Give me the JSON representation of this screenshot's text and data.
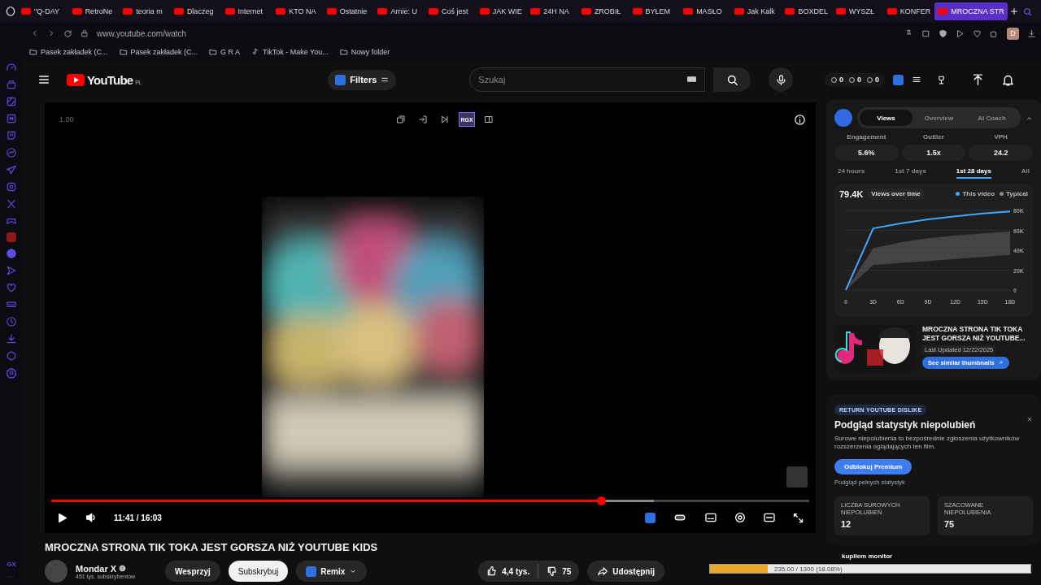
{
  "browser": {
    "tabs": [
      {
        "title": "\"Q-DAY",
        "selected": false
      },
      {
        "title": "RetroNe",
        "selected": false
      },
      {
        "title": "teoria m",
        "selected": false
      },
      {
        "title": "Dlaczeg",
        "selected": false
      },
      {
        "title": "Internet",
        "selected": false
      },
      {
        "title": "KTO NA",
        "selected": false
      },
      {
        "title": "Ostatnie",
        "selected": false
      },
      {
        "title": "Arnie: U",
        "selected": false
      },
      {
        "title": "Coś jest",
        "selected": false
      },
      {
        "title": "JAK WIE",
        "selected": false
      },
      {
        "title": "24H NA",
        "selected": false
      },
      {
        "title": "ZROBIŁ",
        "selected": false
      },
      {
        "title": "BYŁEM",
        "selected": false
      },
      {
        "title": "MASŁO",
        "selected": false
      },
      {
        "title": "Jak Kalk",
        "selected": false
      },
      {
        "title": "BOXDEL",
        "selected": false
      },
      {
        "title": "WYSZŁ",
        "selected": false
      },
      {
        "title": "KONFER",
        "selected": false
      },
      {
        "title": "MROCZNA STR",
        "selected": true
      }
    ],
    "url": "www.youtube.com/watch",
    "profile": "D",
    "bookmarks": [
      {
        "kind": "folder",
        "label": "Pasek zakładek (C..."
      },
      {
        "kind": "folder",
        "label": "Pasek zakładek (C..."
      },
      {
        "kind": "folder",
        "label": "G R A"
      },
      {
        "kind": "tiktok",
        "label": "TikTok - Make You..."
      },
      {
        "kind": "folder",
        "label": "Nowy folder"
      }
    ],
    "sidebar_footer": "GX"
  },
  "header": {
    "logo": "YouTube",
    "region": "PL",
    "filters": "Filters",
    "search": {
      "placeholder": "Szukaj"
    },
    "counters": [
      "0",
      "0",
      "0"
    ]
  },
  "player": {
    "speed": "1.00",
    "toolbar": [
      {
        "kind": "pip",
        "selected": false
      },
      {
        "kind": "enter",
        "selected": false
      },
      {
        "kind": "next",
        "selected": false
      },
      {
        "kind": "text",
        "label": "RGX",
        "selected": true
      },
      {
        "kind": "side",
        "selected": false
      }
    ],
    "progress": {
      "level": 0.725
    },
    "buffered": {
      "level": 0.795
    },
    "time": "11:41 / 16:03"
  },
  "video": {
    "title": "MROCZNA STRONA TIK TOKA JEST GORSZA NIŻ YOUTUBE KIDS",
    "channel": "Mondar X",
    "subscribers": "451 tys. subskrybentów",
    "support": "Wesprzyj",
    "subscribe": "Subskrybuj",
    "remix": "Remix",
    "likes": "4,4 tys.",
    "dislikes": "75",
    "share": "Udostępnij"
  },
  "analytics": {
    "tabs": [
      {
        "label": "Views",
        "selected": true
      },
      {
        "label": "Overview",
        "selected": false
      },
      {
        "label": "AI Coach",
        "selected": false
      }
    ],
    "stats": [
      {
        "label": "Engagement",
        "value": "5.6%"
      },
      {
        "label": "Outlier",
        "value": "1.5x"
      },
      {
        "label": "VPH",
        "value": "24.2"
      }
    ],
    "ranges": [
      {
        "label": "24 hours",
        "selected": false
      },
      {
        "label": "1st 7 days",
        "selected": false
      },
      {
        "label": "1st 28 days",
        "selected": true
      },
      {
        "label": "All",
        "selected": false
      }
    ],
    "total": "79.4K",
    "metric": "Views over time",
    "chart_data": {
      "type": "line",
      "categories": [
        "0",
        "3D",
        "6D",
        "9D",
        "12D",
        "15D",
        "18D"
      ],
      "series": [
        {
          "name": "This video",
          "color": "#3ea6ff",
          "type": "line",
          "values": [
            0,
            62000,
            67000,
            71000,
            74000,
            77000,
            79000
          ]
        },
        {
          "name": "Typical",
          "color": "#8a8a8a",
          "type": "area",
          "values": [
            0,
            42000,
            48000,
            52000,
            55000,
            57000,
            59000
          ]
        }
      ],
      "ylim": [
        0,
        80000
      ],
      "grid": true,
      "yticks": [
        {
          "value": 0,
          "label": "0"
        },
        {
          "value": 20000,
          "label": "20K"
        },
        {
          "value": 40000,
          "label": "40K"
        },
        {
          "value": 60000,
          "label": "60K"
        },
        {
          "value": 80000,
          "label": "80K"
        }
      ]
    },
    "thumbnail": {
      "title": "MROCZNA STRONA TIK TOKA JEST GORSZA NIŻ YOUTUBE...",
      "updated": "Last Updated 12/22/2025",
      "action": "See similar thumbnails"
    }
  },
  "dislikes": {
    "badge": "RETURN YOUTUBE DISLIKE",
    "heading": "Podgląd statystyk niepolubień",
    "text": "Surowe niepolubienia to bezpośrednie zgłoszenia użytkowników rozszerzenia oglądających ten film.",
    "button": "Odblokuj Premium",
    "note": "Podgląd pełnych statystyk",
    "cards": [
      {
        "label": "LICZBA SUROWYCH NIEPOLUBIEŃ",
        "value": "12"
      },
      {
        "label": "SZACOWANE NIEPOLUBIENIA",
        "value": "75"
      }
    ]
  },
  "goal": {
    "title": "kupiłem monitor",
    "reading": "235.00 / 1300 (18.08%)",
    "level": 0.1808
  }
}
